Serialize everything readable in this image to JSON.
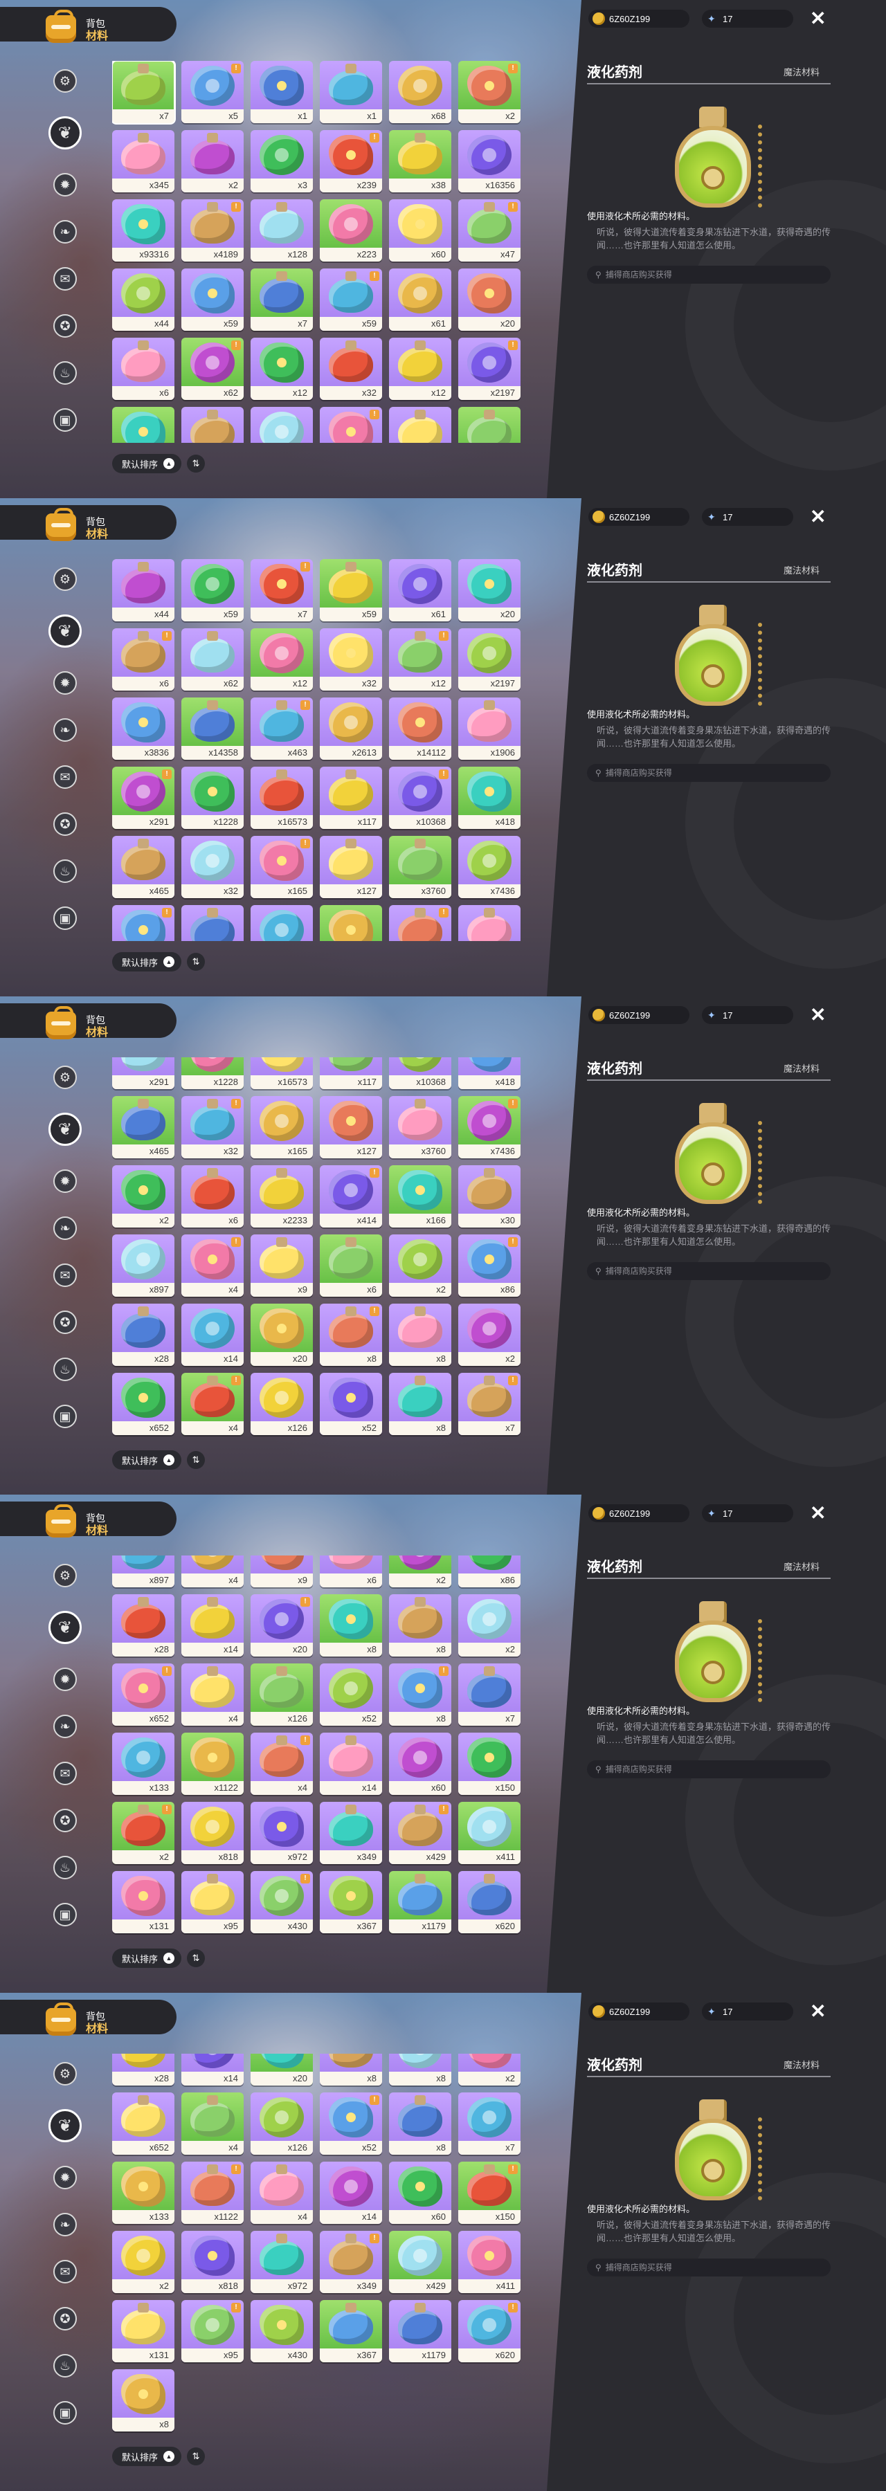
{
  "header": {
    "title": "背包",
    "subtitle": "材料"
  },
  "categories": [
    {
      "icon": "gear-icon",
      "glyph": "⚙"
    },
    {
      "icon": "leaf-icon",
      "glyph": "❦"
    },
    {
      "icon": "spiky-orb-icon",
      "glyph": "✹"
    },
    {
      "icon": "sprout-icon",
      "glyph": "❧"
    },
    {
      "icon": "scroll-icon",
      "glyph": "✉"
    },
    {
      "icon": "star-badge-icon",
      "glyph": "✪"
    },
    {
      "icon": "pot-icon",
      "glyph": "♨"
    },
    {
      "icon": "chest-icon",
      "glyph": "▣"
    }
  ],
  "sort": {
    "label": "默认排序",
    "direction_glyph": "▲",
    "toggle_glyph": "⇅"
  },
  "currency": {
    "gold": "6Z60Z199",
    "gems": "17"
  },
  "detail": {
    "name": "液化药剂",
    "type": "魔法材料",
    "use": "使用液化术所必需的材料。",
    "description": "听说，彼得大道流传着变身果冻钻进下水道，获得奇遇的传闻……也许那里有人知道怎么使用。",
    "source": "捕得商店购买获得",
    "close_glyph": "✕"
  },
  "frames": [
    {
      "offset": 0,
      "rows": [
        [
          "x7",
          "x5",
          "x1",
          "x1",
          "x68",
          "x2"
        ],
        [
          "x345",
          "x2",
          "x3",
          "x239",
          "x38",
          "x16356"
        ],
        [
          "x93316",
          "x4189",
          "x128",
          "x223",
          "x60",
          "x47"
        ],
        [
          "x44",
          "x59",
          "x7",
          "x59",
          "x61",
          "x20"
        ],
        [
          "x6",
          "x62",
          "x12",
          "x32",
          "x12",
          "x2197"
        ],
        [
          "x3836",
          "x14358",
          "x463",
          "x2613",
          "x14112",
          "x1906"
        ]
      ]
    },
    {
      "offset": 0,
      "rows": [
        [
          "x44",
          "x59",
          "x7",
          "x59",
          "x61",
          "x20"
        ],
        [
          "x6",
          "x62",
          "x12",
          "x32",
          "x12",
          "x2197"
        ],
        [
          "x3836",
          "x14358",
          "x463",
          "x2613",
          "x14112",
          "x1906"
        ],
        [
          "x291",
          "x1228",
          "x16573",
          "x117",
          "x10368",
          "x418"
        ],
        [
          "x465",
          "x32",
          "x165",
          "x127",
          "x3760",
          "x7436"
        ],
        [
          "x2",
          "x6",
          "x2233",
          "x414",
          "x166",
          "x30"
        ]
      ]
    },
    {
      "offset": -44,
      "rows": [
        [
          "x291",
          "x1228",
          "x16573",
          "x117",
          "x10368",
          "x418"
        ],
        [
          "x465",
          "x32",
          "x165",
          "x127",
          "x3760",
          "x7436"
        ],
        [
          "x2",
          "x6",
          "x2233",
          "x414",
          "x166",
          "x30"
        ],
        [
          "x897",
          "x4",
          "x9",
          "x6",
          "x2",
          "x86"
        ],
        [
          "x28",
          "x14",
          "x20",
          "x8",
          "x8",
          "x2"
        ],
        [
          "x652",
          "x4",
          "x126",
          "x52",
          "x8",
          "x7"
        ]
      ]
    },
    {
      "offset": -44,
      "rows": [
        [
          "x897",
          "x4",
          "x9",
          "x6",
          "x2",
          "x86"
        ],
        [
          "x28",
          "x14",
          "x20",
          "x8",
          "x8",
          "x2"
        ],
        [
          "x652",
          "x4",
          "x126",
          "x52",
          "x8",
          "x7"
        ],
        [
          "x133",
          "x1122",
          "x4",
          "x14",
          "x60",
          "x150"
        ],
        [
          "x2",
          "x818",
          "x972",
          "x349",
          "x429",
          "x411"
        ],
        [
          "x131",
          "x95",
          "x430",
          "x367",
          "x1179",
          "x620"
        ]
      ]
    },
    {
      "offset": -44,
      "rows": [
        [
          "x28",
          "x14",
          "x20",
          "x8",
          "x8",
          "x2"
        ],
        [
          "x652",
          "x4",
          "x126",
          "x52",
          "x8",
          "x7"
        ],
        [
          "x133",
          "x1122",
          "x4",
          "x14",
          "x60",
          "x150"
        ],
        [
          "x2",
          "x818",
          "x972",
          "x349",
          "x429",
          "x411"
        ],
        [
          "x131",
          "x95",
          "x430",
          "x367",
          "x1179",
          "x620"
        ],
        [
          "x8"
        ]
      ]
    }
  ],
  "art_colors": [
    "#9fd14a",
    "#5aa0e8",
    "#4f7fd8",
    "#4fb6e0",
    "#e9b84a",
    "#e87a5a",
    "#ff9cc0",
    "#c04ed0",
    "#3fbe5a",
    "#e8543a",
    "#f2d23a",
    "#7a5ae8",
    "#3ad0c0",
    "#d6a35a",
    "#a0e0f0",
    "#f27aa8",
    "#ffe26a",
    "#8ad06a"
  ],
  "art_shapes": [
    "flask",
    "ring",
    "flower",
    "flask",
    "ring",
    "flower",
    "flask"
  ]
}
